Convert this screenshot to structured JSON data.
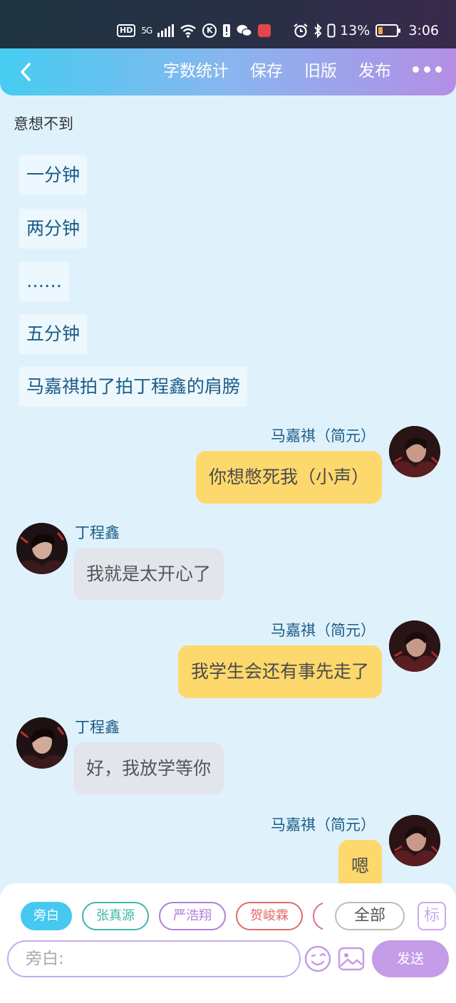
{
  "status_bar": {
    "hd": "HD",
    "network": "5G",
    "k": "K",
    "battery": "13%",
    "time": "3:06"
  },
  "toolbar": {
    "word_count": "字数统计",
    "save": "保存",
    "old_version": "旧版",
    "publish": "发布"
  },
  "story": {
    "intro": "意想不到",
    "narrations": [
      "一分钟",
      "两分钟",
      "……",
      "五分钟",
      "马嘉祺拍了拍丁程鑫的肩膀"
    ],
    "messages": [
      {
        "speaker": "马嘉祺（简元）",
        "text": "你想憋死我（小声）"
      },
      {
        "speaker": "丁程鑫",
        "text": "我就是太开心了"
      },
      {
        "speaker": "马嘉祺（简元）",
        "text": "我学生会还有事先走了"
      },
      {
        "speaker": "丁程鑫",
        "text": "好，我放学等你"
      },
      {
        "speaker": "马嘉祺（简元）",
        "text": "嗯"
      }
    ]
  },
  "composer": {
    "roles": [
      "旁白",
      "张真源",
      "严浩翔",
      "贺峻霖"
    ],
    "all_label": "全部",
    "mark_label": "标",
    "input_placeholder": "旁白:",
    "send_label": "发送",
    "colors": {
      "narrator": "#46c8f0",
      "zhang": "#3bb8a8",
      "yan": "#b07fd6",
      "he": "#e06a6a",
      "accent": "#c49ce8"
    }
  }
}
